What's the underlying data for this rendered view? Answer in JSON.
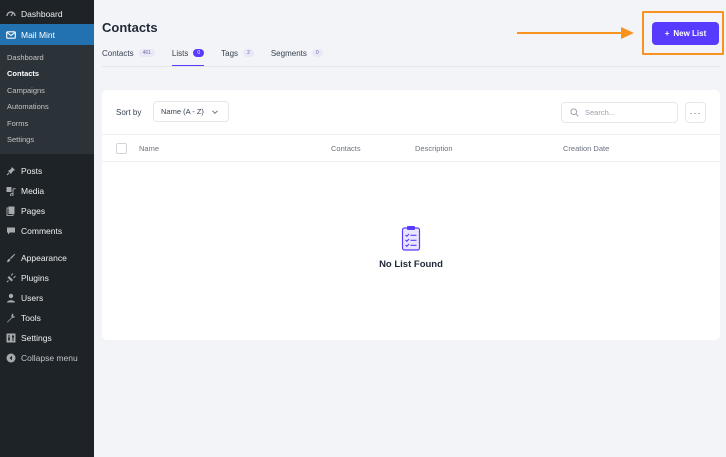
{
  "sidebar": {
    "dashboard": "Dashboard",
    "plugin": "Mail Mint",
    "submenu": [
      "Dashboard",
      "Contacts",
      "Campaigns",
      "Automations",
      "Forms",
      "Settings"
    ],
    "items": [
      "Posts",
      "Media",
      "Pages",
      "Comments",
      "Appearance",
      "Plugins",
      "Users",
      "Tools",
      "Settings",
      "Collapse menu"
    ]
  },
  "header": {
    "title": "Contacts",
    "new_button": "New List"
  },
  "tabs": [
    {
      "label": "Contacts",
      "count": "461"
    },
    {
      "label": "Lists",
      "count": "0"
    },
    {
      "label": "Tags",
      "count": "2"
    },
    {
      "label": "Segments",
      "count": "0"
    }
  ],
  "toolbar": {
    "sort_label": "Sort by",
    "sort_value": "Name (A - Z)",
    "search_placeholder": "Search...",
    "more": "···"
  },
  "table": {
    "columns": [
      "Name",
      "Contacts",
      "Description",
      "Creation Date"
    ]
  },
  "empty_state": {
    "message": "No List Found"
  },
  "colors": {
    "accent": "#573bff",
    "highlight": "#f7931e",
    "sidebar_bg": "#1d2327",
    "sidebar_active": "#2271b1"
  }
}
